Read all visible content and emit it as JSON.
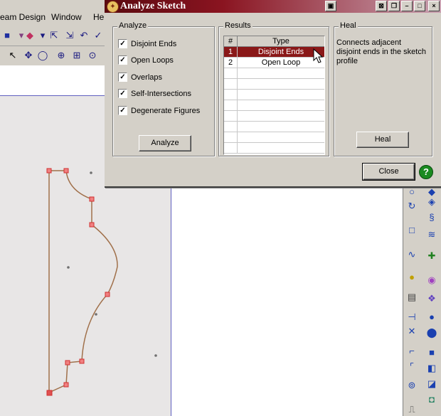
{
  "app": {
    "menu": [
      "eam Design",
      "Window",
      "He"
    ]
  },
  "dialog": {
    "title": "Analyze Sketch",
    "analyze": {
      "legend": "Analyze",
      "checks": [
        {
          "label": "Disjoint Ends",
          "checked": true
        },
        {
          "label": "Open Loops",
          "checked": true
        },
        {
          "label": "Overlaps",
          "checked": true
        },
        {
          "label": "Self-Intersections",
          "checked": true
        },
        {
          "label": "Degenerate Figures",
          "checked": true
        }
      ],
      "button": "Analyze"
    },
    "results": {
      "legend": "Results",
      "columns": [
        "#",
        "Type"
      ],
      "rows": [
        {
          "num": "1",
          "type": "Disjoint Ends",
          "selected": true
        },
        {
          "num": "2",
          "type": "Open Loop",
          "selected": false
        }
      ]
    },
    "heal": {
      "legend": "Heal",
      "description": "Connects adjacent disjoint ends in the sketch profile",
      "button": "Heal"
    },
    "close_label": "Close",
    "help_glyph": "?",
    "check_glyph": "✓"
  },
  "colors": {
    "title_bar": "#8a1420",
    "selection": "#8a1818",
    "sketch_line": "#a0704a",
    "sketch_point": "#e05050"
  }
}
